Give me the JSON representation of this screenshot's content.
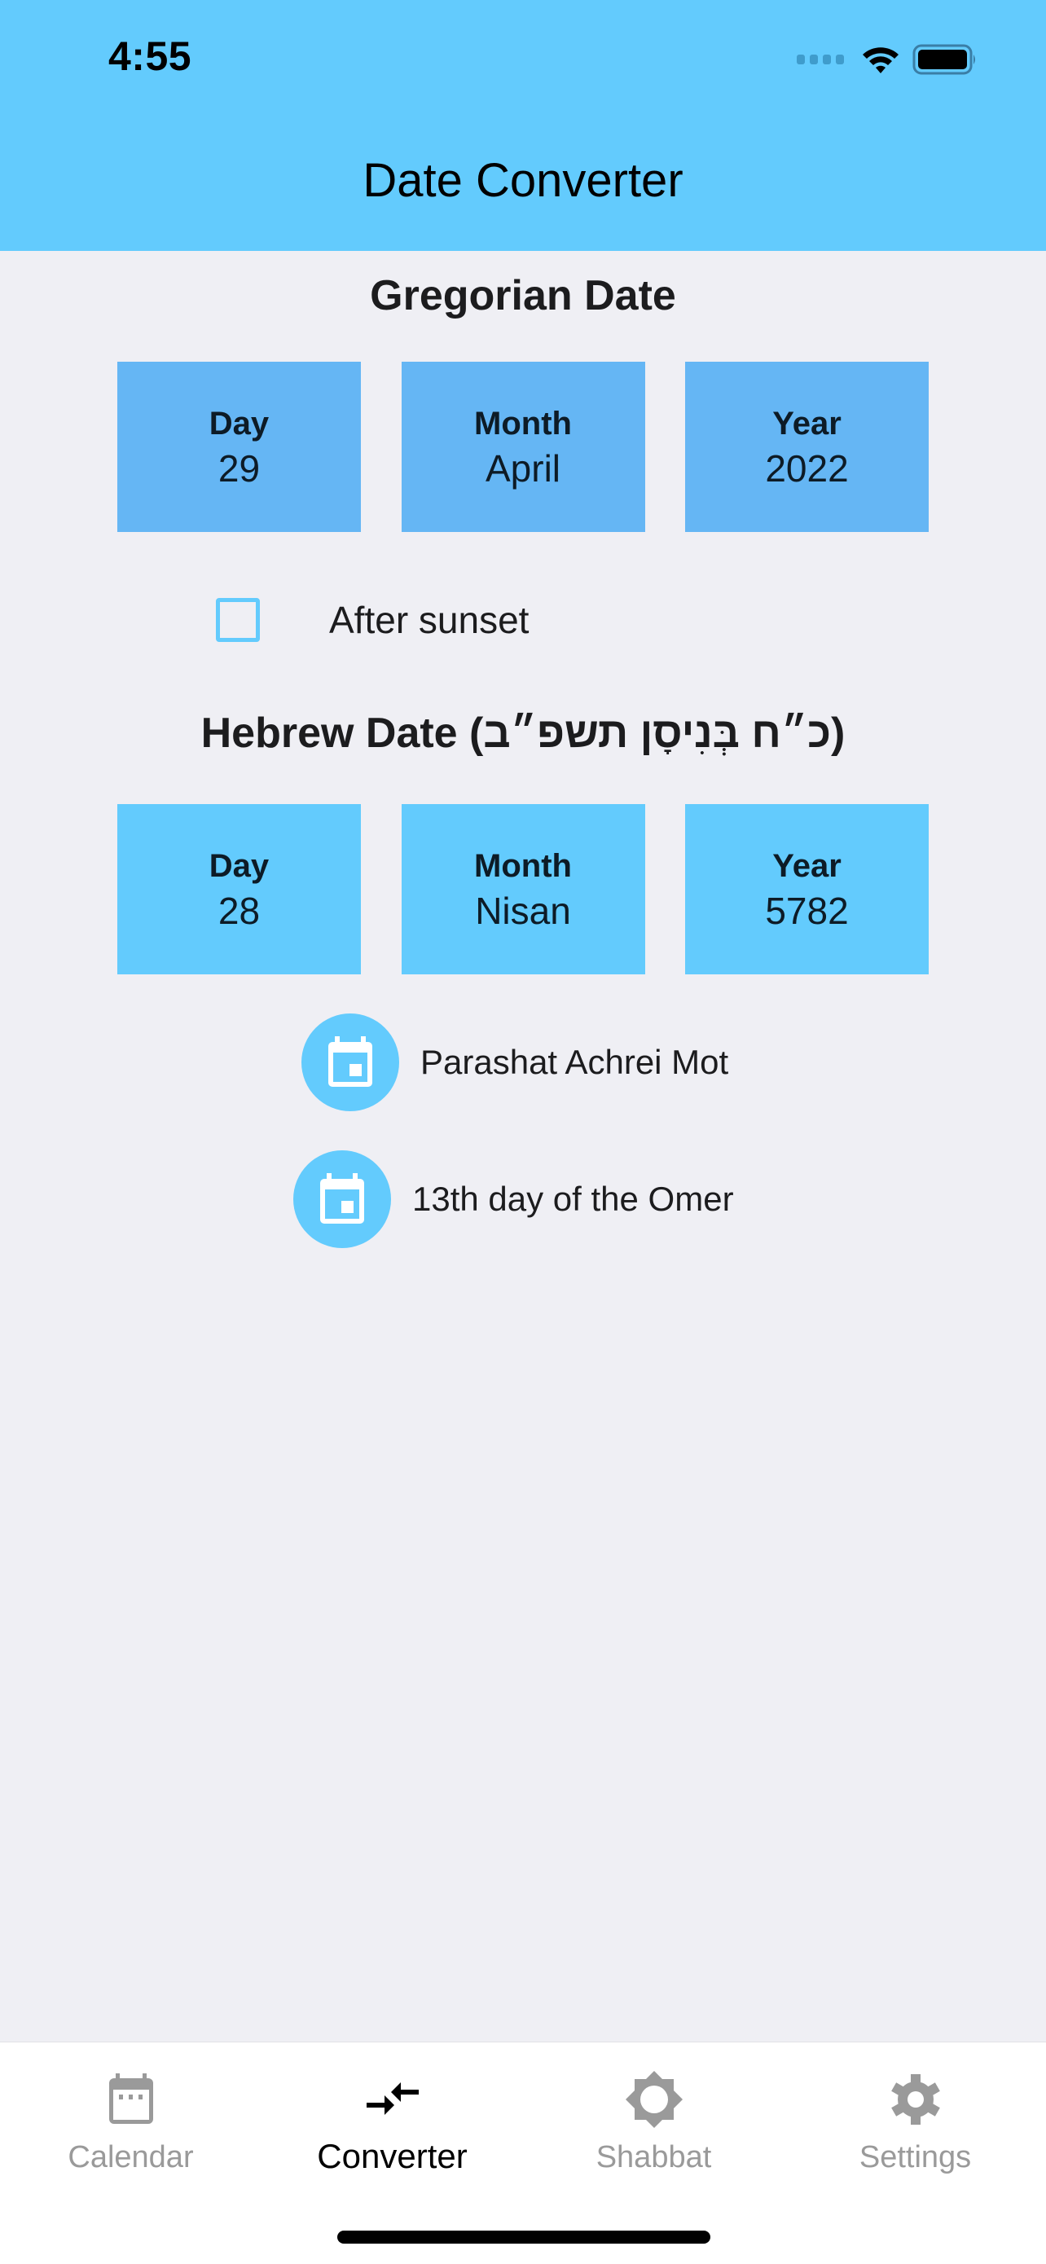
{
  "status_bar": {
    "time": "4:55",
    "icons": [
      "cellular-signal-icon",
      "wifi-icon",
      "battery-icon"
    ]
  },
  "nav": {
    "title": "Date Converter"
  },
  "colors": {
    "header": "#63cbfd",
    "gregorian_box": "#65b6f4",
    "hebrew_box": "#63cbfd",
    "background": "#efeff4",
    "tab_inactive": "#9a9a9a",
    "tab_active": "#000000"
  },
  "gregorian": {
    "title": "Gregorian Date",
    "fields": [
      {
        "label": "Day",
        "value": "29"
      },
      {
        "label": "Month",
        "value": "April"
      },
      {
        "label": "Year",
        "value": "2022"
      }
    ]
  },
  "after_sunset": {
    "label": "After sunset",
    "checked": false
  },
  "hebrew": {
    "title": "Hebrew Date (כ״ח בְּנִיסָן תשפ״ב)",
    "fields": [
      {
        "label": "Day",
        "value": "28"
      },
      {
        "label": "Month",
        "value": "Nisan"
      },
      {
        "label": "Year",
        "value": "5782"
      }
    ]
  },
  "events": [
    {
      "icon": "calendar-event-icon",
      "text": "Parashat Achrei Mot"
    },
    {
      "icon": "calendar-event-icon",
      "text": "13th day of the Omer"
    }
  ],
  "tabs": [
    {
      "label": "Calendar",
      "icon": "calendar-icon",
      "active": false
    },
    {
      "label": "Converter",
      "icon": "compare-arrows-icon",
      "active": true
    },
    {
      "label": "Shabbat",
      "icon": "star-of-david-sun-icon",
      "active": false
    },
    {
      "label": "Settings",
      "icon": "gear-icon",
      "active": false
    }
  ]
}
